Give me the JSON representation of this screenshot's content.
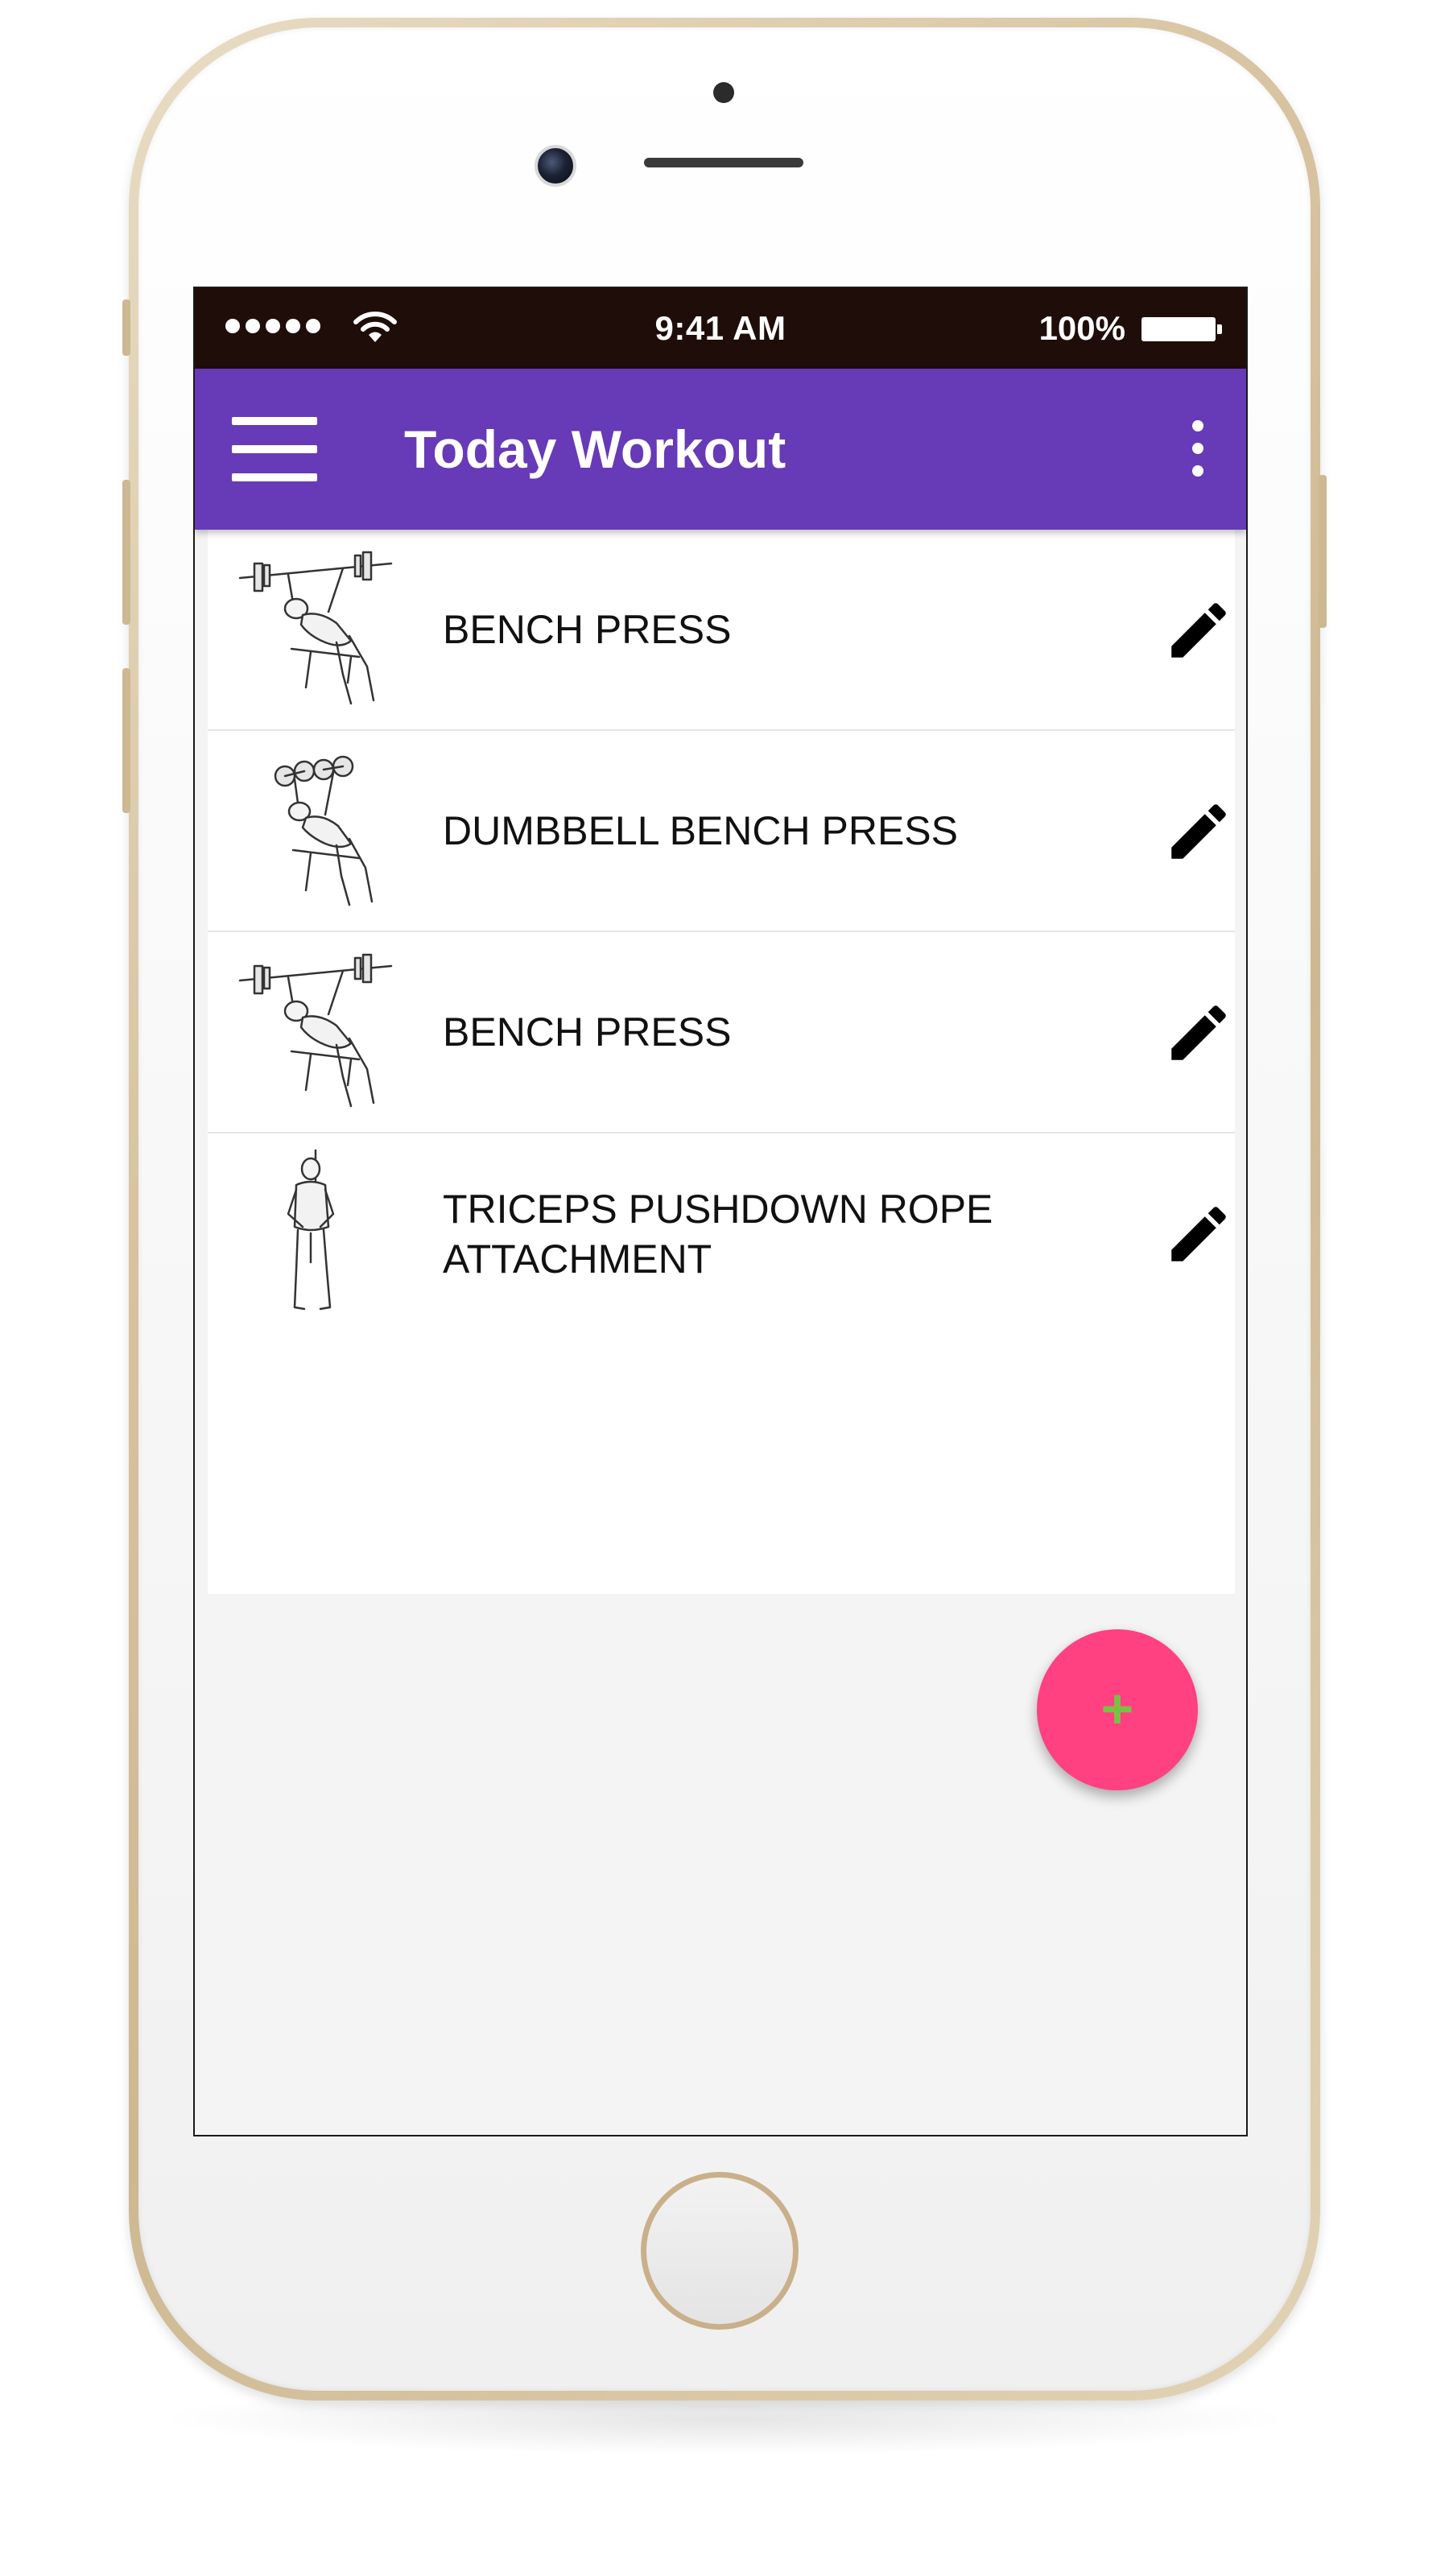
{
  "status_bar": {
    "time": "9:41 AM",
    "battery": "100%"
  },
  "app_bar": {
    "title": "Today Workout",
    "menu_icon": "hamburger-menu-icon",
    "overflow_icon": "more-vert-icon",
    "background": "#673ab7"
  },
  "workouts": [
    {
      "name": "BENCH PRESS",
      "icon": "barbell-bench-press-illustration"
    },
    {
      "name": "DUMBBELL BENCH PRESS",
      "icon": "dumbbell-bench-press-illustration"
    },
    {
      "name": "BENCH PRESS",
      "icon": "barbell-bench-press-illustration"
    },
    {
      "name": "TRICEPS PUSHDOWN ROPE ATTACHMENT",
      "icon": "triceps-pushdown-illustration"
    }
  ],
  "edit_icon": "pencil-icon",
  "fab": {
    "label": "+",
    "icon": "add-icon",
    "background": "#ff4081",
    "icon_color": "#7ac142"
  }
}
